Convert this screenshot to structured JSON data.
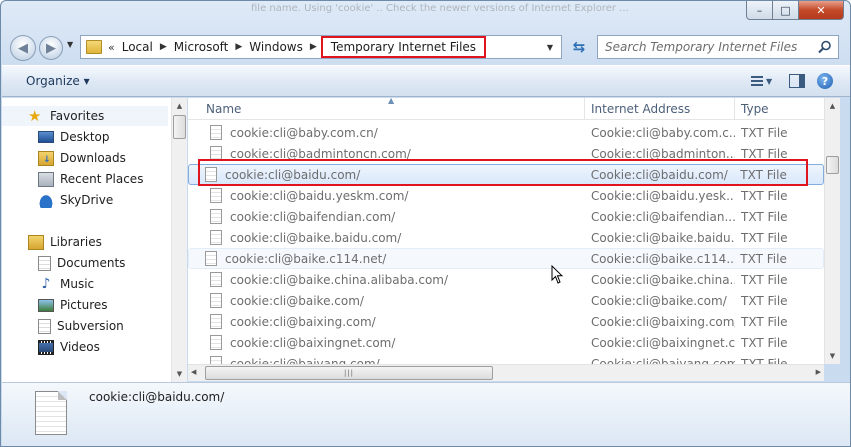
{
  "window": {
    "background_title": "file name. Using 'cookie' .. Check the newer versions of Internet Explorer ..."
  },
  "caption": {
    "minimize": "–",
    "maximize": "□",
    "close": "✕"
  },
  "navigation": {
    "breadcrumb": [
      "«",
      "Local",
      "Microsoft",
      "Windows",
      "Temporary Internet Files"
    ],
    "search_placeholder": "Search Temporary Internet Files"
  },
  "toolbar": {
    "organize_label": "Organize ▾",
    "help_label": "?"
  },
  "sidebar": {
    "favorites": {
      "label": "Favorites",
      "items": [
        "Desktop",
        "Downloads",
        "Recent Places",
        "SkyDrive"
      ]
    },
    "libraries": {
      "label": "Libraries",
      "items": [
        "Documents",
        "Music",
        "Pictures",
        "Subversion",
        "Videos"
      ]
    }
  },
  "columns": {
    "name": "Name",
    "address": "Internet Address",
    "type": "Type"
  },
  "files": [
    {
      "name": "cookie:cli@baby.com.cn/",
      "address": "Cookie:cli@baby.com.c...",
      "type": "TXT File"
    },
    {
      "name": "cookie:cli@badmintoncn.com/",
      "address": "Cookie:cli@badminton...",
      "type": "TXT File"
    },
    {
      "name": "cookie:cli@baidu.com/",
      "address": "Cookie:cli@baidu.com/",
      "type": "TXT File"
    },
    {
      "name": "cookie:cli@baidu.yeskm.com/",
      "address": "Cookie:cli@baidu.yesk...",
      "type": "TXT File"
    },
    {
      "name": "cookie:cli@baifendian.com/",
      "address": "Cookie:cli@baifendian....",
      "type": "TXT File"
    },
    {
      "name": "cookie:cli@baike.baidu.com/",
      "address": "Cookie:cli@baike.baidu....",
      "type": "TXT File"
    },
    {
      "name": "cookie:cli@baike.c114.net/",
      "address": "Cookie:cli@baike.c114....",
      "type": "TXT File"
    },
    {
      "name": "cookie:cli@baike.china.alibaba.com/",
      "address": "Cookie:cli@baike.china....",
      "type": "TXT File"
    },
    {
      "name": "cookie:cli@baike.com/",
      "address": "Cookie:cli@baike.com/",
      "type": "TXT File"
    },
    {
      "name": "cookie:cli@baixing.com/",
      "address": "Cookie:cli@baixing.com/",
      "type": "TXT File"
    },
    {
      "name": "cookie:cli@baixingnet.com/",
      "address": "Cookie:cli@baixingnet.com/",
      "type": "TXT File"
    },
    {
      "name": "cookie:cli@baiyang.com/",
      "address": "Cookie:cli@baiyang.com/",
      "type": "TXT File"
    }
  ],
  "details": {
    "selected_name": "cookie:cli@baidu.com/"
  }
}
